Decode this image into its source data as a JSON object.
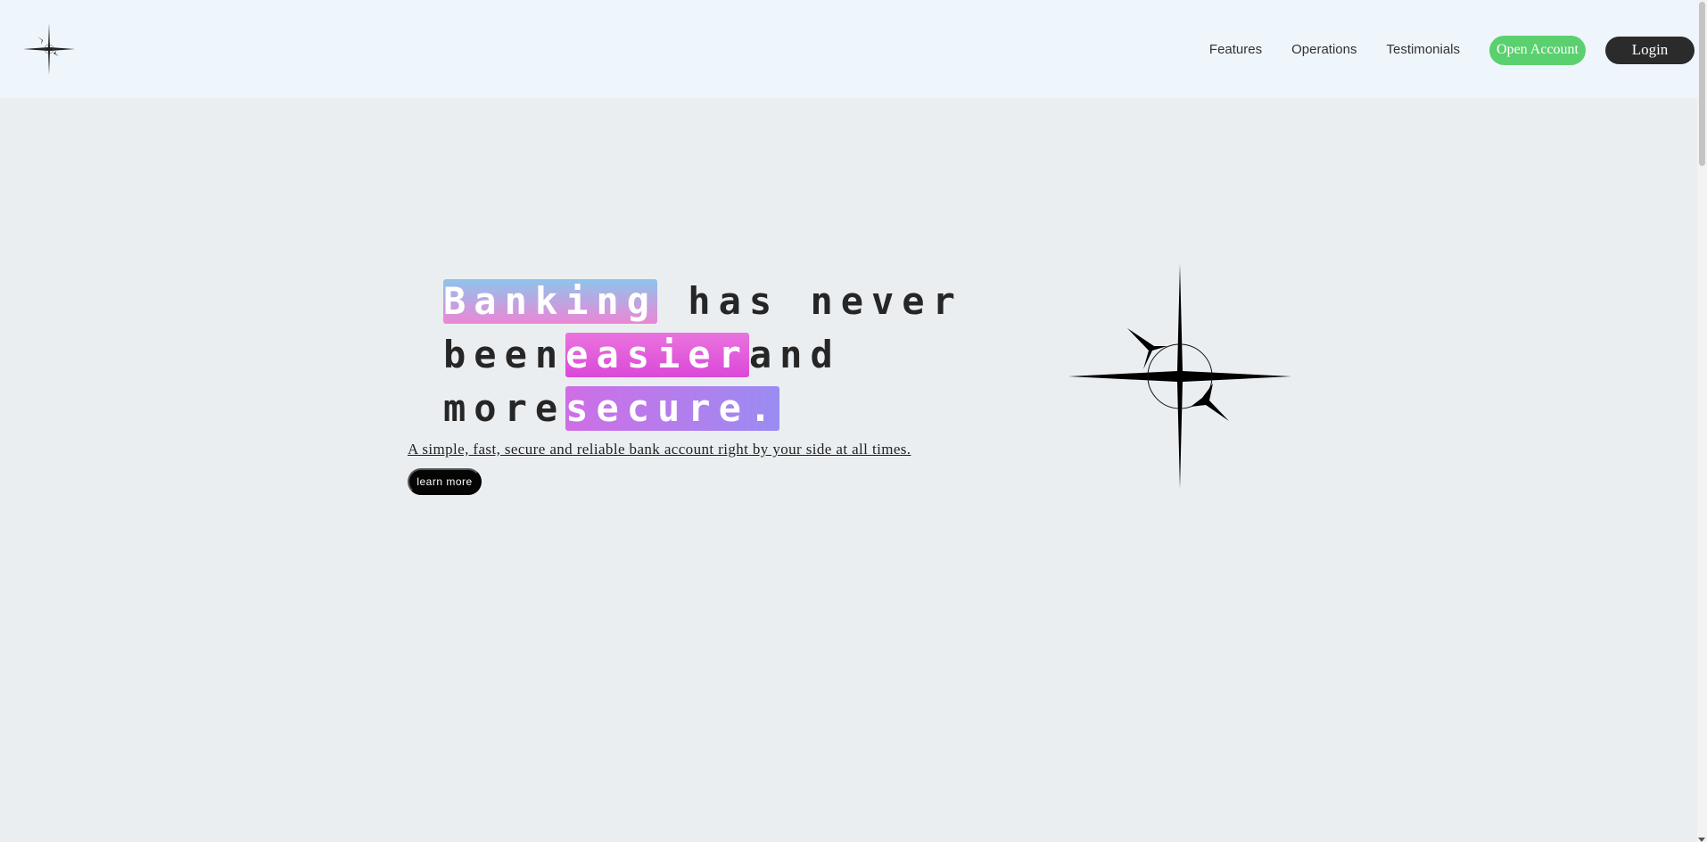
{
  "header": {
    "logo_icon": "compass-star-icon",
    "nav": {
      "features": "Features",
      "operations": "Operations",
      "testimonials": "Testimonials",
      "open_account": "Open Account",
      "login": "Login"
    }
  },
  "hero": {
    "title": {
      "w1": "Banking",
      "w2": " has never",
      "w3": "been",
      "w4": "easier",
      "w5": "and",
      "w6": "more",
      "w7": "secure."
    },
    "subtitle": "A simple, fast, secure and reliable bank account right by your side at all times.",
    "cta": "learn more",
    "illustration": "compass-star-icon"
  },
  "colors": {
    "header_bg": "#eef5fb",
    "page_bg": "#ebeef1",
    "open_account": "#5ad06f",
    "login": "#2b2b2b"
  }
}
